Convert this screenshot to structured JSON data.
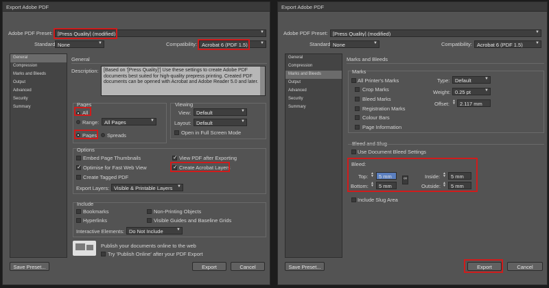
{
  "left": {
    "title": "Export Adobe PDF",
    "preset_label": "Adobe PDF Preset:",
    "preset_value": "[Press Quality] (modified)",
    "standard_label": "Standard:",
    "standard_value": "None",
    "compat_label": "Compatibility:",
    "compat_value": "Acrobat 6 (PDF 1.5)",
    "nav": [
      "General",
      "Compression",
      "Marks and Bleeds",
      "Output",
      "Advanced",
      "Security",
      "Summary"
    ],
    "section_title": "General",
    "description_label": "Description:",
    "description": "[Based on '[Press Quality]'] Use these settings to create Adobe PDF documents best suited for high-quality prepress printing.  Created PDF documents can be opened with Acrobat and Adobe Reader 5.0 and later.",
    "pages": {
      "title": "Pages",
      "all": "All",
      "range": "Range:",
      "range_value": "All Pages",
      "pages": "Pages",
      "spreads": "Spreads"
    },
    "viewing": {
      "title": "Viewing",
      "view_label": "View:",
      "view_value": "Default",
      "layout_label": "Layout:",
      "layout_value": "Default",
      "fullscreen": "Open in Full Screen Mode"
    },
    "options": {
      "title": "Options",
      "embed_thumbs": "Embed Page Thumbnails",
      "optimise": "Optimise for Fast Web View",
      "tagged": "Create Tagged PDF",
      "view_after": "View PDF after Exporting",
      "acrobat_layers": "Create Acrobat Layers",
      "export_layers_label": "Export Layers:",
      "export_layers_value": "Visible & Printable Layers"
    },
    "include": {
      "title": "Include",
      "bookmarks": "Bookmarks",
      "hyperlinks": "Hyperlinks",
      "non_printing": "Non-Printing Objects",
      "guides": "Visible Guides and Baseline Grids",
      "interactive_label": "Interactive Elements:",
      "interactive_value": "Do Not Include"
    },
    "publish_text": "Publish your documents online to the web",
    "publish_try": "Try 'Publish Online' after your PDF Export",
    "save_preset": "Save Preset...",
    "export": "Export",
    "cancel": "Cancel"
  },
  "right": {
    "title": "Export Adobe PDF",
    "preset_label": "Adobe PDF Preset:",
    "preset_value": "[Press Quality] (modified)",
    "standard_label": "Standard:",
    "standard_value": "None",
    "compat_label": "Compatibility:",
    "compat_value": "Acrobat 6 (PDF 1.5)",
    "nav": [
      "General",
      "Compression",
      "Marks and Bleeds",
      "Output",
      "Advanced",
      "Security",
      "Summary"
    ],
    "section_title": "Marks and Bleeds",
    "marks": {
      "title": "Marks",
      "all_printers": "All Printer's Marks",
      "crop": "Crop Marks",
      "bleed": "Bleed Marks",
      "registration": "Registration Marks",
      "colour_bars": "Colour Bars",
      "page_info": "Page Information",
      "type_label": "Type:",
      "type_value": "Default",
      "weight_label": "Weight:",
      "weight_value": "0.25 pt",
      "offset_label": "Offset:",
      "offset_value": "2.117 mm"
    },
    "bleed_slug": {
      "title": "Bleed and Slug",
      "use_doc": "Use Document Bleed Settings",
      "bleed_label": "Bleed:",
      "top_label": "Top:",
      "top_value": "5 mm",
      "bottom_label": "Bottom:",
      "bottom_value": "5 mm",
      "inside_label": "Inside:",
      "inside_value": "5 mm",
      "outside_label": "Outside:",
      "outside_value": "5 mm",
      "include_slug": "Include Slug Area"
    },
    "save_preset": "Save Preset...",
    "export": "Export",
    "cancel": "Cancel"
  }
}
